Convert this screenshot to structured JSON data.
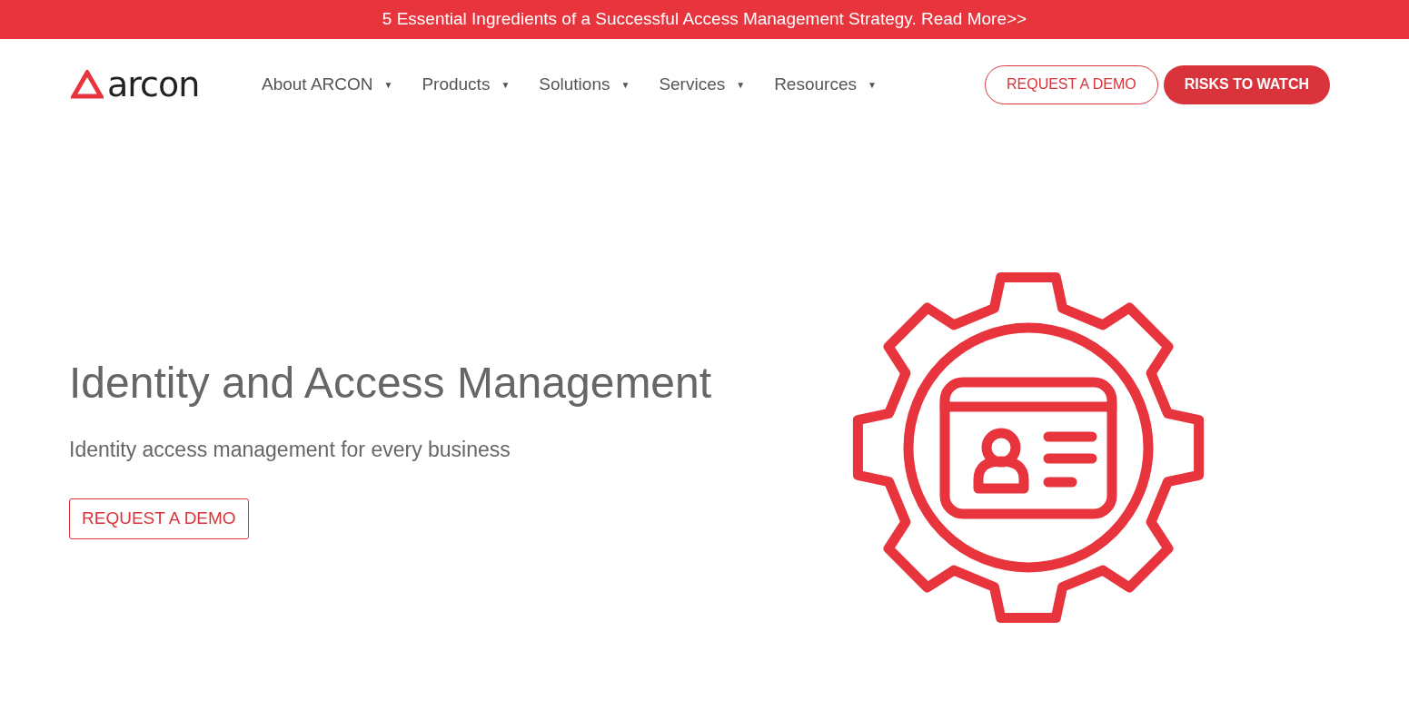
{
  "banner": {
    "text": "5 Essential Ingredients of a Successful Access Management Strategy. Read More>>"
  },
  "logo": {
    "text": "arcon"
  },
  "nav": [
    {
      "label": "About ARCON",
      "caret": "▼"
    },
    {
      "label": "Products",
      "caret": "▼"
    },
    {
      "label": "Solutions",
      "caret": "▼"
    },
    {
      "label": "Services",
      "caret": "▼"
    },
    {
      "label": "Resources",
      "caret": "▼"
    }
  ],
  "header_buttons": [
    {
      "label": "REQUEST A DEMO",
      "kind": "outline"
    },
    {
      "label": "RISKS TO WATCH",
      "kind": "filled"
    }
  ],
  "hero": {
    "title": "Identity and Access Management",
    "subtitle": "Identity access management for every business",
    "button": "REQUEST A DEMO"
  }
}
